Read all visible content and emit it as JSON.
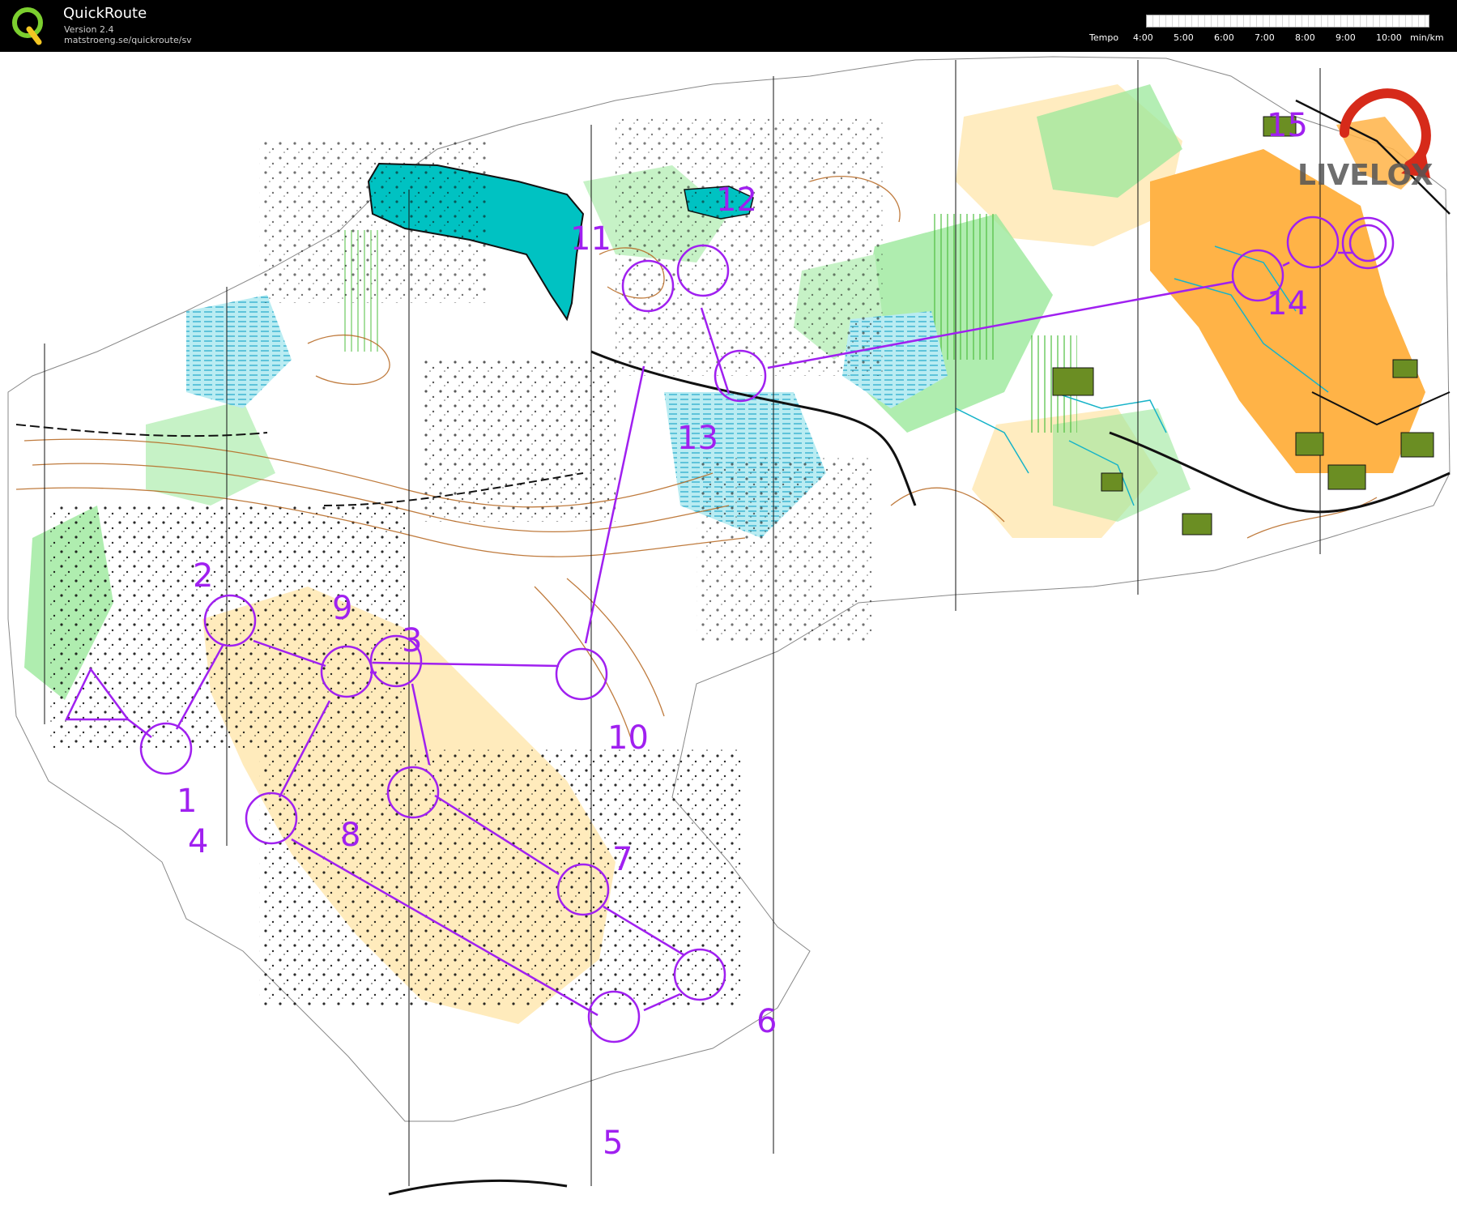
{
  "header": {
    "title": "QuickRoute",
    "version": "Version 2.4",
    "url": "matstroeng.se/quickroute/sv"
  },
  "tempo": {
    "label": "Tempo",
    "ticks": [
      "4:00",
      "5:00",
      "6:00",
      "7:00",
      "8:00",
      "9:00",
      "10:00"
    ],
    "unit": "min/km"
  },
  "watermark": {
    "text": "LIVELOX"
  },
  "course": {
    "color": "#a020f0",
    "controls": [
      "1",
      "2",
      "3",
      "4",
      "5",
      "6",
      "7",
      "8",
      "9",
      "10",
      "11",
      "12",
      "13",
      "14",
      "15"
    ]
  },
  "map": {
    "water_color": "#00c2c2",
    "open_land_color": "#ffb347",
    "forest_green_color": "#7fdc7f",
    "contour_color": "#b5651d"
  }
}
